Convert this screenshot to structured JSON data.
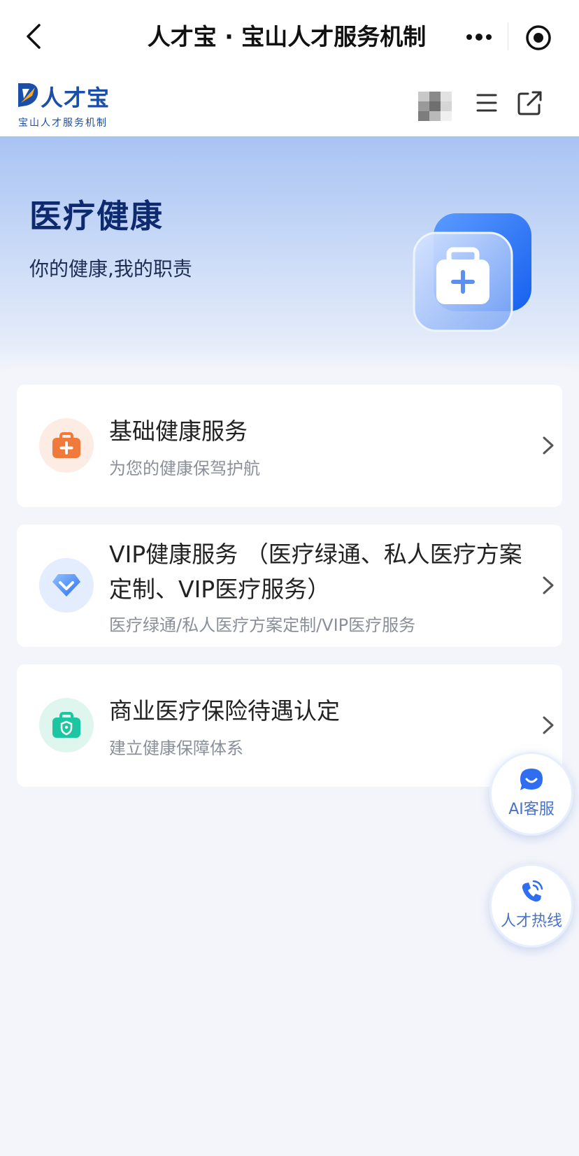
{
  "window": {
    "title": "人才宝 · 宝山人才服务机制"
  },
  "site_header": {
    "logo_text": "人才宝",
    "logo_subtitle": "宝山人才服务机制"
  },
  "hero": {
    "title": "医疗健康",
    "subtitle": "你的健康,我的职责"
  },
  "services": [
    {
      "title": "基础健康服务",
      "description": "为您的健康保驾护航",
      "icon": "first-aid-kit-icon"
    },
    {
      "title": "VIP健康服务 （医疗绿通、私人医疗方案定制、VIP医疗服务）",
      "description": "医疗绿通/私人医疗方案定制/VIP医疗服务",
      "icon": "diamond-icon"
    },
    {
      "title": "商业医疗保险待遇认定",
      "description": "建立健康保障体系",
      "icon": "insurance-briefcase-icon"
    }
  ],
  "floating": {
    "ai_service_label": "AI客服",
    "hotline_label": "人才热线"
  },
  "colors": {
    "brand_blue": "#1a4ea8",
    "accent_blue": "#3d7df5",
    "orange": "#f07a3c",
    "teal": "#1cc6a0",
    "page_bg": "#f3f5fa"
  }
}
